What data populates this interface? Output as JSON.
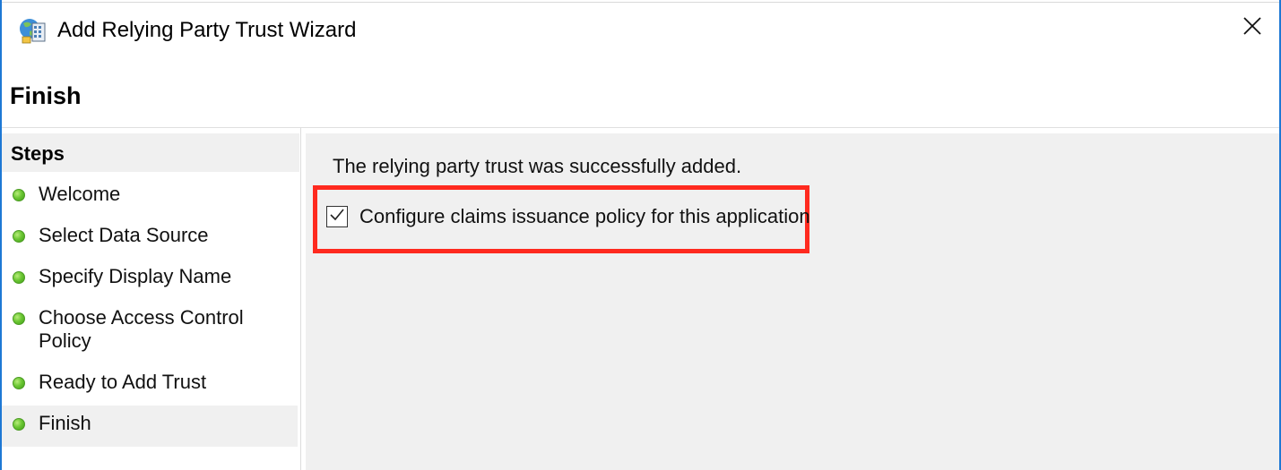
{
  "window": {
    "title": "Add Relying Party Trust Wizard",
    "icon": "adfs-trust-icon",
    "close_icon": "close-icon"
  },
  "header": {
    "title": "Finish"
  },
  "steps": {
    "heading": "Steps",
    "items": [
      {
        "label": "Welcome",
        "status_color": "#6cc734"
      },
      {
        "label": "Select Data Source",
        "status_color": "#6cc734"
      },
      {
        "label": "Specify Display Name",
        "status_color": "#6cc734"
      },
      {
        "label_line1": "Choose Access Control",
        "label_line2": "Policy",
        "status_color": "#6cc734"
      },
      {
        "label": "Ready to Add Trust",
        "status_color": "#6cc734"
      },
      {
        "label": "Finish",
        "status_color": "#6cc734",
        "active": true
      }
    ]
  },
  "main": {
    "message": "The relying party trust was successfully added.",
    "checkbox": {
      "label": "Configure claims issuance policy for this application",
      "checked": true
    },
    "highlight_color": "#ff2a1f"
  }
}
